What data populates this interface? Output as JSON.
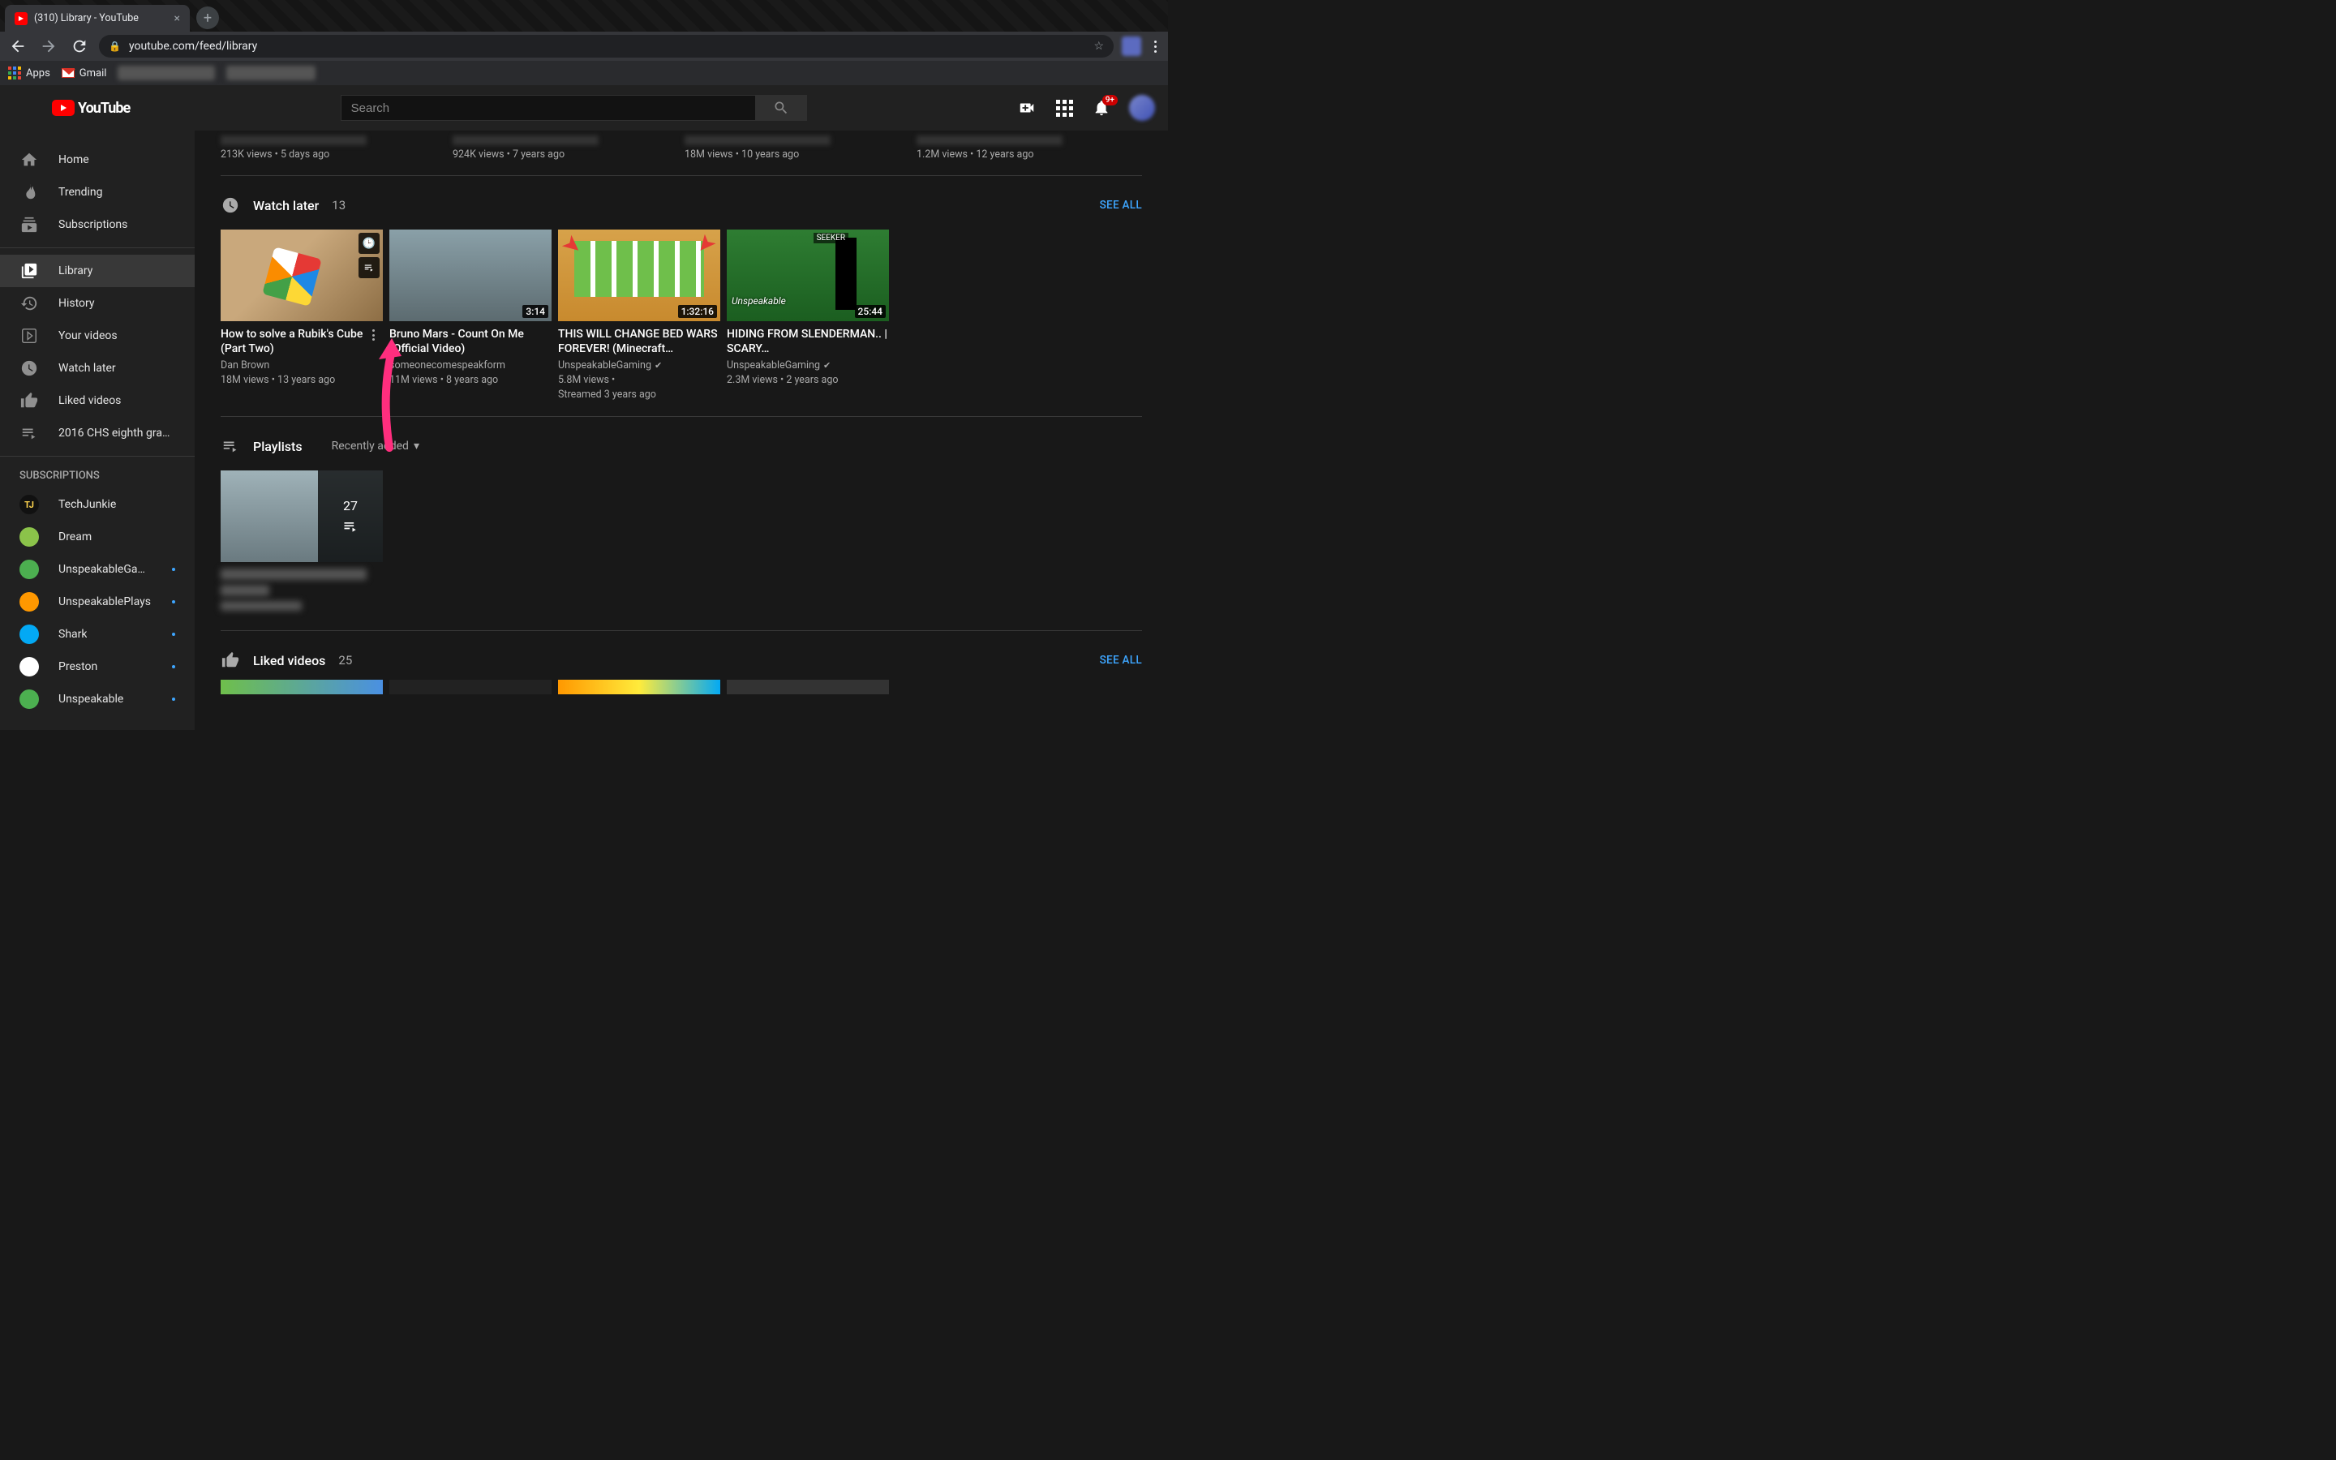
{
  "browser": {
    "tab_title": "(310) Library - YouTube",
    "url": "youtube.com/feed/library",
    "bookmarks": {
      "apps": "Apps",
      "gmail": "Gmail"
    }
  },
  "topbar": {
    "logo_text": "YouTube",
    "search_placeholder": "Search",
    "notification_count": "9+"
  },
  "sidebar": {
    "main": [
      {
        "label": "Home"
      },
      {
        "label": "Trending"
      },
      {
        "label": "Subscriptions"
      }
    ],
    "library": [
      {
        "label": "Library"
      },
      {
        "label": "History"
      },
      {
        "label": "Your videos"
      },
      {
        "label": "Watch later"
      },
      {
        "label": "Liked videos"
      },
      {
        "label": "2016 CHS eighth gra…"
      }
    ],
    "subs_heading": "SUBSCRIPTIONS",
    "subs": [
      {
        "label": "TechJunkie",
        "dot": false
      },
      {
        "label": "Dream",
        "dot": false
      },
      {
        "label": "UnspeakableGami…",
        "dot": true
      },
      {
        "label": "UnspeakablePlays",
        "dot": true
      },
      {
        "label": "Shark",
        "dot": true
      },
      {
        "label": "Preston",
        "dot": true
      },
      {
        "label": "Unspeakable",
        "dot": true
      }
    ]
  },
  "partial_row": [
    "213K views • 5 days ago",
    "924K views • 7 years ago",
    "18M views • 10 years ago",
    "1.2M views • 12 years ago"
  ],
  "watch_later": {
    "title": "Watch later",
    "count": "13",
    "see_all": "SEE ALL",
    "videos": [
      {
        "title": "How to solve a Rubik's Cube (Part Two)",
        "channel": "Dan Brown",
        "verified": false,
        "meta": "18M views • 13 years ago",
        "duration": "",
        "hover": true
      },
      {
        "title": "Bruno Mars - Count On Me (Official Video)",
        "channel": "someonecomespeakform",
        "verified": false,
        "meta": "11M views • 8 years ago",
        "duration": "3:14"
      },
      {
        "title": "THIS WILL CHANGE BED WARS FOREVER! (Minecraft…",
        "channel": "UnspeakableGaming",
        "verified": true,
        "meta": "5.8M views •",
        "meta2": "Streamed 3 years ago",
        "duration": "1:32:16"
      },
      {
        "title": "HIDING FROM SLENDERMAN.. | SCARY…",
        "channel": "UnspeakableGaming",
        "verified": true,
        "meta": "2.3M views • 2 years ago",
        "duration": "25:44"
      }
    ]
  },
  "playlists": {
    "title": "Playlists",
    "sort": "Recently added",
    "items": [
      {
        "count": "27"
      }
    ]
  },
  "liked": {
    "title": "Liked videos",
    "count": "25",
    "see_all": "SEE ALL"
  }
}
